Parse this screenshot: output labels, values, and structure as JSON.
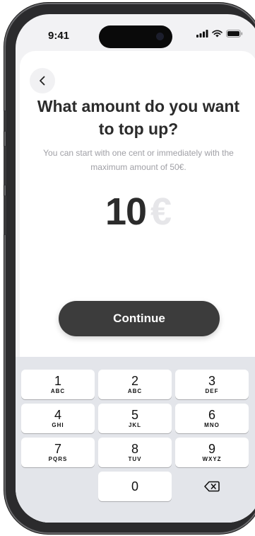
{
  "status_bar": {
    "time": "9:41"
  },
  "header": {
    "title": "What amount do you want to top up?",
    "subtitle": "You can start with one cent or immediately with the maximum amount of 50€."
  },
  "amount": {
    "value": "10",
    "currency": "€"
  },
  "continue_label": "Continue",
  "keypad": {
    "keys": [
      {
        "digit": "1",
        "letters": "ABC"
      },
      {
        "digit": "2",
        "letters": "ABC"
      },
      {
        "digit": "3",
        "letters": "DEF"
      },
      {
        "digit": "4",
        "letters": "GHI"
      },
      {
        "digit": "5",
        "letters": "JKL"
      },
      {
        "digit": "6",
        "letters": "MNO"
      },
      {
        "digit": "7",
        "letters": "PQRS"
      },
      {
        "digit": "8",
        "letters": "TUV"
      },
      {
        "digit": "9",
        "letters": "WXYZ"
      },
      {
        "digit": "0",
        "letters": ""
      }
    ],
    "delete_icon": "backspace-icon"
  },
  "colors": {
    "button_dark": "#3c3c3c",
    "text_dark": "#2b2b2b",
    "muted": "#a0a0a6",
    "keypad_bg": "#e3e5ea"
  }
}
